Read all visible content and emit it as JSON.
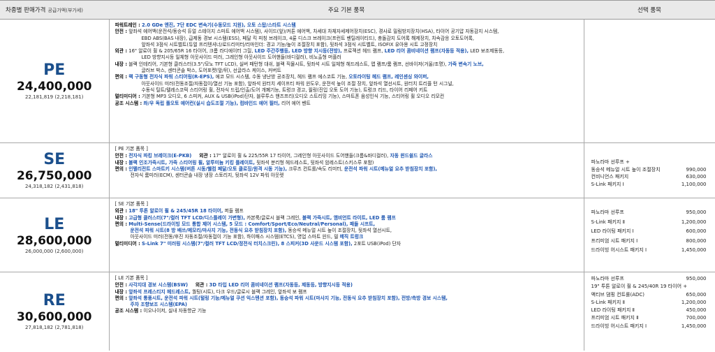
{
  "header": {
    "trim_price": "차종별 판매가격",
    "trim_price_sub": "공급가액(부가세)",
    "basic": "주요 기본 품목",
    "options": "선택 품목"
  },
  "rows": {
    "pe": {
      "name": "PE",
      "price": "24,400,000",
      "price_sub": "22,181,819 (2,218,181)",
      "lines": {
        "l1_k": "파워트레인 :",
        "l1_h": "2.0 GDe 엔진, 7단 EDC 변속기(수동모드 지원), 오토 스탑/스타트 시스템",
        "l2_k": "안전 :",
        "l2_t": "앞좌석 에어백(운전석/동승석 듀얼 스테이지 스마트 에어백 시스템), 사이드(앞)/커튼 에어백, 차세대 차체자세제어장치(ESC), 경사로 밀림방지장치(HSA), 타이어 공기압 자동감지 시스템,",
        "l3": "EBD ABS(BAS 내장), 급제동 경보 시스템(ESS), 페달 킥 피칭 브레이크, 4륜 디스크 브레이크(프런트 벤틸레이티드), 충돌감지 도어록 해제장치, 차속감응 오토도어록,",
        "l4": "앞좌석 3점식 시트벨트(듀얼 프리텐셔너/로드리미터/리마인더: 경고 기능/높이 조절장치 포함), 뒷좌석 3점식 시트벨트, ISOFIX 유아용 시트 고정장치",
        "l5_k": "외관 :",
        "l5_a": "16\" 알로이 휠 & 205/65R 16 타이어, 크롬 라디에이터 그릴,",
        "l5_h1": "LED 주간주행등, LED 방향 지시등(전방),",
        "l5_b": "프로젝션 헤드 램프,",
        "l5_h2": "LED 리어 콤비네이션 램프(자동등 적용),",
        "l5_c": "LED 보조제동등,",
        "l6": "LED 방향지시등 일체형 아웃사이드 미러, 그레인형 아웃사이드 도어핸들(바디컬러), 비노출형 머플러",
        "l7_k": "내장 :",
        "l7_t": "블랙 인테리어, 기본형 클러스터(3.5\"/모노 TFT LCD), 실버 패턴형 대쉬, 블랙 직물시트, 뒷좌석 시트 일체형 헤드레스트, 맵 램프/룸 램프, 선바이저(거울/조명),",
        "l7_h": "가죽 변속기 노브,",
        "l8": "글러브 박스, 센터콘솔 박스, 도어포켓(앞/뒤), 선글라스 케이스, 커버트",
        "l9_k": "편의 :",
        "l9_h1": "랙 구동형 전자식 파워 스티어링(R-EPS),",
        "l9_a": "에코 모드 시스템, 수동 냉난방 공조장치, 헤드 램프 에스코트 기능,",
        "l9_h2": "오토라이팅 헤드 램프, 레인센싱 와이퍼,",
        "l10": "아웃사이드 미러(전동조절/자동접이/열선 기능 포함), 앞좌석 원터치 세이프티 파워 윈도우, 운전석 높이 조절 장치, 앞좌석 열선시트, 원터치 트리플 턴 시그널,",
        "l11": "수동식 틸트/텔레스코픽 스티어링 휠, 전자식 드립/인출/도어 개폐기능, 트렁크 경고, 필링(진입 오토 도어 기능), 트렁크 리드, 타이어 리페어 키트",
        "l12_k": "멀티미디어 :",
        "l12_t": "기본형 MP3 오디오, 6 스피커, AUX & USB(iPod)단자, 블루투스 핸즈프리(오디오 스트리밍 기능), 스마트폰 음성인식 기능, 스티어링 휠 오디오 리모컨",
        "l13_k": "공조 시스템 :",
        "l13_h": "좌/우 독립 풀오토 에어컨(실시 습도조절 기능), 컴바인드 에어 필터,",
        "l13_t": "리어 에어 벤트"
      },
      "options": []
    },
    "se": {
      "name": "SE",
      "price": "26,750,000",
      "price_sub": "24,318,182 (2,431,818)",
      "lines": {
        "h": "[ PE 기본 품목 ]",
        "l1_k": "안전 :",
        "l1_h": "전자식 파킹 브레이크(E-PKB)",
        "l1_k2": "외관 :",
        "l1_t": "17\" 알로이 휠 & 225/55R 17 타이어, 그레인형 아웃사이드 도어핸들(크롬&바디컬러),",
        "l1_h2": "자동 윈드쉴드 글라스",
        "l2_k": "내장 :",
        "l2_h": "블랙 인조가죽시트, 가죽 스티어링 휠, 알루미늄 키킹 플레이트,",
        "l2_t": "뒷좌석 분리형 헤드레스트, 뒷좌석 암레스트(스키스루 포함)",
        "l3_k": "편의 :",
        "l3_h1": "인텔리전트 스마트키 시스템(버튼 시동/웰컴 페달/오토 클로징/원격 시동 기능),",
        "l3_t": "크루즈 컨트롤/속도 리미터,",
        "l3_h2": "운전석 파워 시트(메뉴얼 요추 받침장치 포함),",
        "l4": "전자식 룸미러(ECM), 센터콘솔 내장 냉장 스토리지, 뒷좌석 12V 파워 아웃렛"
      },
      "options": [
        {
          "label": "파노라마 선루프 +",
          "price": ""
        },
        {
          "label": "동승석 메뉴얼 시트 높이 조절장치",
          "price": "990,000"
        },
        {
          "label": "컨비니언스 패키지",
          "price": "630,000"
        },
        {
          "label": "S-Link 패키지 Ⅰ",
          "price": "1,100,000"
        }
      ]
    },
    "le": {
      "name": "LE",
      "price": "28,600,000",
      "price_sub": "26,000,000 (2,600,000)",
      "lines": {
        "h": "[ SE 기본 품목 ]",
        "l1_k": "외관 :",
        "l1_h": "18\" 투톤 알로이 휠 & 245/45R 18 타이어,",
        "l1_t": "퍼들 램프",
        "l2_k": "내장 :",
        "l2_h1": "고급형 클러스터(7\"/컬러 TFT LCD/디스플레이 가변형),",
        "l2_a": "카본룩/글로시 블랙 그레인,",
        "l2_h2": "블랙 가죽시트, 앰비언트 라이트, LED 룸 램프",
        "l3_k": "편의 :",
        "l3_h": "Multi-Sense(드라이빙 모드 통합 제어 시스템, 5 모드 : Comfort/Sport/Eco/Neutral/Personal), 패들 시프트,",
        "l4_h": "운전석 파워 시트(8 방 배쓰/메모리/마사지 기능, 전동식 요추 받침장치 포함),",
        "l4_t": "동승석 메뉴얼 시트 높이 조절장치, 뒷좌석 열선시트,",
        "l5_t": "아웃사이드 미러(전동/후진 자동조절/자동접이 기능 포함), 하이패스 시스템(ETCS), 영업 스마트 윈드, 필",
        "l5_h": "메직 트렁크",
        "l6_k": "멀티미디어 :",
        "l6_h": "S-Link 7\" 미러링 시스템(7\"/컬러 TFT LCD/정전식 터치스크린), 8 스피커(3D 사운드 시스템 포함),",
        "l6_t": "2포트 USB(iPod) 단자"
      },
      "options": [
        {
          "label": "파노라마 선루프",
          "price": "950,000"
        },
        {
          "label": "S-Link 패키지 Ⅱ",
          "price": "1,200,000"
        },
        {
          "label": "LED 라이팅 패키지 Ⅰ",
          "price": "600,000"
        },
        {
          "label": "프리미엄 시트 패키지 Ⅰ",
          "price": "800,000"
        },
        {
          "label": "드라이빙 어시스트 패키지 Ⅰ",
          "price": "1,450,000"
        }
      ]
    },
    "re": {
      "name": "RE",
      "price": "30,600,000",
      "price_sub": "27,818,182 (2,781,818)",
      "lines": {
        "h": "[ LE 기본 품목 ]",
        "l1_k": "안전 :",
        "l1_h": "사각지대 경보 시스템(BSW)",
        "l1_k2": "외관 :",
        "l1_h2": "3D 타입 LED 리어 콤비네이션 램프(자동등, 제동등, 방향지시등 적용)",
        "l2_k": "내장 :",
        "l2_h": "앞좌석 프레스티지 헤드레스트,",
        "l2_t": "퀄팅(시트), 다크 우드/글로시 블랙 그레인, 앞좌석 보 램프",
        "l3_k": "편의 :",
        "l3_h": "앞좌석 통풍시트, 운전석 파워 시트(털링 기능/메뉴얼 쿠션 익스텐션 포함), 동승석 파워 시트(마사지 기능, 전동식 요추 받침장치 포함), 전방/측방 경보 시스템,",
        "l4_h": "주차 조향보조 시스템(EPA)",
        "l5_k": "공조 시스템 :",
        "l5_t": "이오나이저, 실내 자동향균 기능"
      },
      "options": [
        {
          "label": "파노라마 선루프",
          "price": "950,000"
        },
        {
          "label": "19\" 투톤 알로이 휠 & 245/40R 19 타이어 +",
          "price": ""
        },
        {
          "label": "액티브 댐핑 컨트롤(ADC)",
          "price": "650,000"
        },
        {
          "label": "S-Link 패키지 Ⅱ",
          "price": "1,200,000"
        },
        {
          "label": "LED 라이팅 패키지 Ⅱ",
          "price": "450,000"
        },
        {
          "label": "프리미엄 시트 패키지 Ⅱ",
          "price": "700,000"
        },
        {
          "label": "드라이빙 어시스트 패키지 Ⅰ",
          "price": "1,450,000"
        }
      ]
    }
  }
}
